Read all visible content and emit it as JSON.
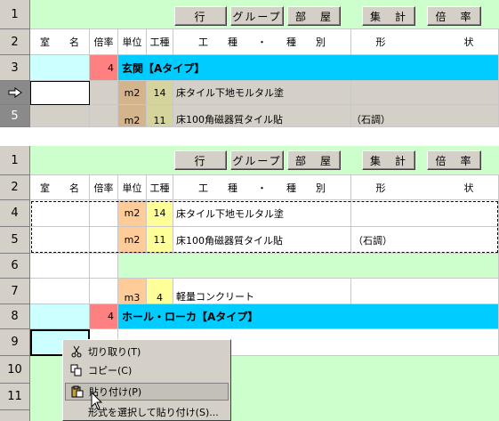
{
  "toolbar": {
    "row": "行",
    "group": "グループ",
    "room": "部　屋",
    "total": "集　計",
    "ratio": "倍　率"
  },
  "headers": {
    "room_name": "室　　名",
    "multiplier": "倍率",
    "unit": "単位",
    "work_type": "工種",
    "work_category": "工　　種　　・　　種　　別",
    "shape": "形　　　　　　　　状"
  },
  "top_grid": {
    "row_numbers": [
      "1",
      "2",
      "3",
      "",
      "5"
    ],
    "section_row": {
      "multiplier": "4",
      "title": "玄関【Aタイプ】"
    },
    "rows": [
      {
        "unit": "m2",
        "code": "14",
        "description": "床タイル下地モルタル塗",
        "shape": ""
      },
      {
        "unit": "m2",
        "code": "11",
        "description": "床100角磁器質タイル貼",
        "shape": "（石調）"
      }
    ]
  },
  "bottom_grid": {
    "row_numbers": [
      "1",
      "2",
      "4",
      "5",
      "6",
      "7",
      "8",
      "9",
      "10",
      "11"
    ],
    "rows": [
      {
        "unit": "m2",
        "code": "14",
        "description": "床タイル下地モルタル塗",
        "shape": ""
      },
      {
        "unit": "m2",
        "code": "11",
        "description": "床100角磁器質タイル貼",
        "shape": "（石調）"
      },
      {
        "unit": "m3",
        "code": "4",
        "description": "軽量コンクリート",
        "shape": ""
      }
    ],
    "section_row": {
      "multiplier": "4",
      "title": "ホール・ローカ【Aタイプ】"
    }
  },
  "context_menu": {
    "items": [
      {
        "label": "切り取り(T)",
        "icon": "scissors-icon"
      },
      {
        "label": "コピー(C)",
        "icon": "copy-icon"
      },
      {
        "label": "貼り付け(P)",
        "icon": "paste-icon"
      },
      {
        "label": "形式を選択して貼り付け(S)...",
        "icon": ""
      }
    ]
  },
  "colors": {
    "green_bg": "#ccffcc",
    "light_cyan": "#ccffff",
    "section_blue": "#00ccff",
    "salmon": "#ff8080",
    "unit_orange": "#ffcc99",
    "code_yellow": "#ffff99",
    "selected_gray": "#d4d0c8"
  }
}
